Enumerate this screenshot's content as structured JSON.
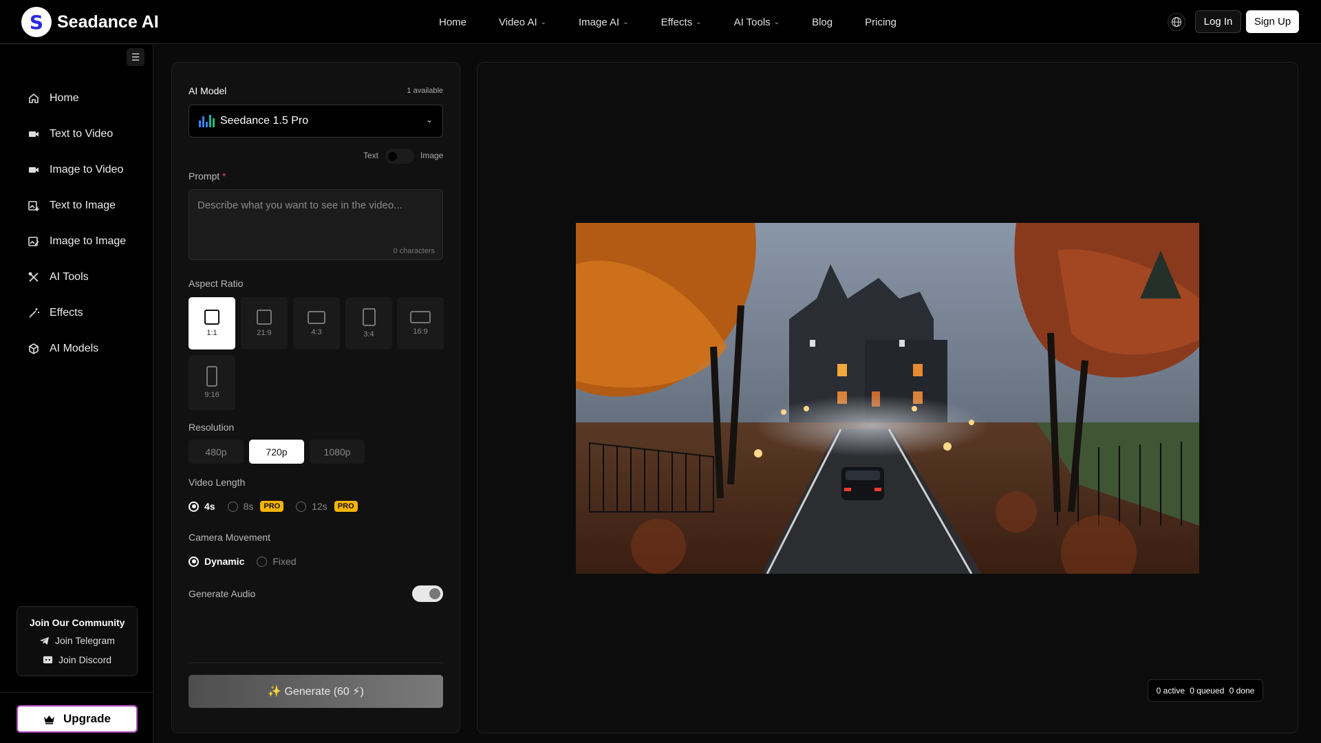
{
  "brand": {
    "logo_letter": "S",
    "name": "Seadance AI"
  },
  "nav": {
    "items": [
      {
        "label": "Home",
        "dropdown": false
      },
      {
        "label": "Video AI",
        "dropdown": true
      },
      {
        "label": "Image AI",
        "dropdown": true
      },
      {
        "label": "Effects",
        "dropdown": true
      },
      {
        "label": "AI Tools",
        "dropdown": true
      },
      {
        "label": "Blog",
        "dropdown": false
      },
      {
        "label": "Pricing",
        "dropdown": false
      }
    ],
    "login": "Log In",
    "signup": "Sign Up"
  },
  "sidebar": {
    "items": [
      {
        "label": "Home",
        "icon": "home-icon"
      },
      {
        "label": "Text to Video",
        "icon": "video-camera-icon"
      },
      {
        "label": "Image to Video",
        "icon": "video-camera-icon"
      },
      {
        "label": "Text to Image",
        "icon": "image-plus-icon"
      },
      {
        "label": "Image to Image",
        "icon": "image-edit-icon"
      },
      {
        "label": "AI Tools",
        "icon": "tools-icon"
      },
      {
        "label": "Effects",
        "icon": "magic-wand-icon"
      },
      {
        "label": "AI Models",
        "icon": "cube-icon"
      }
    ],
    "community": {
      "title": "Join Our Community",
      "telegram": "Join Telegram",
      "discord": "Join Discord"
    },
    "upgrade": "Upgrade"
  },
  "form": {
    "model_label": "AI Model",
    "model_available": "1 available",
    "model_value": "Seedance 1.5 Pro",
    "mode_text": "Text",
    "mode_image": "Image",
    "prompt_label": "Prompt",
    "prompt_required": "*",
    "prompt_placeholder": "Describe what you want to see in the video...",
    "prompt_count": "0 characters",
    "aspect_label": "Aspect Ratio",
    "aspect_ratios": [
      "1:1",
      "21:9",
      "4:3",
      "3:4",
      "16:9",
      "9:16"
    ],
    "aspect_selected": "1:1",
    "resolution_label": "Resolution",
    "resolutions": [
      "480p",
      "720p",
      "1080p"
    ],
    "resolution_selected": "720p",
    "length_label": "Video Length",
    "lengths": [
      "4s",
      "8s",
      "12s"
    ],
    "pro_badge": "PRO",
    "camera_label": "Camera Movement",
    "camera_options": [
      "Dynamic",
      "Fixed"
    ],
    "audio_label": "Generate Audio",
    "audio_on": true,
    "generate": "✨ Generate (60 ⚡)"
  },
  "status": {
    "active": "0 active",
    "queued": "0 queued",
    "done": "0 done"
  },
  "colors": {
    "pro_badge": "#f5b400",
    "upgrade_border": "#b44cc4",
    "accent_blue": "#2a2ae0"
  }
}
